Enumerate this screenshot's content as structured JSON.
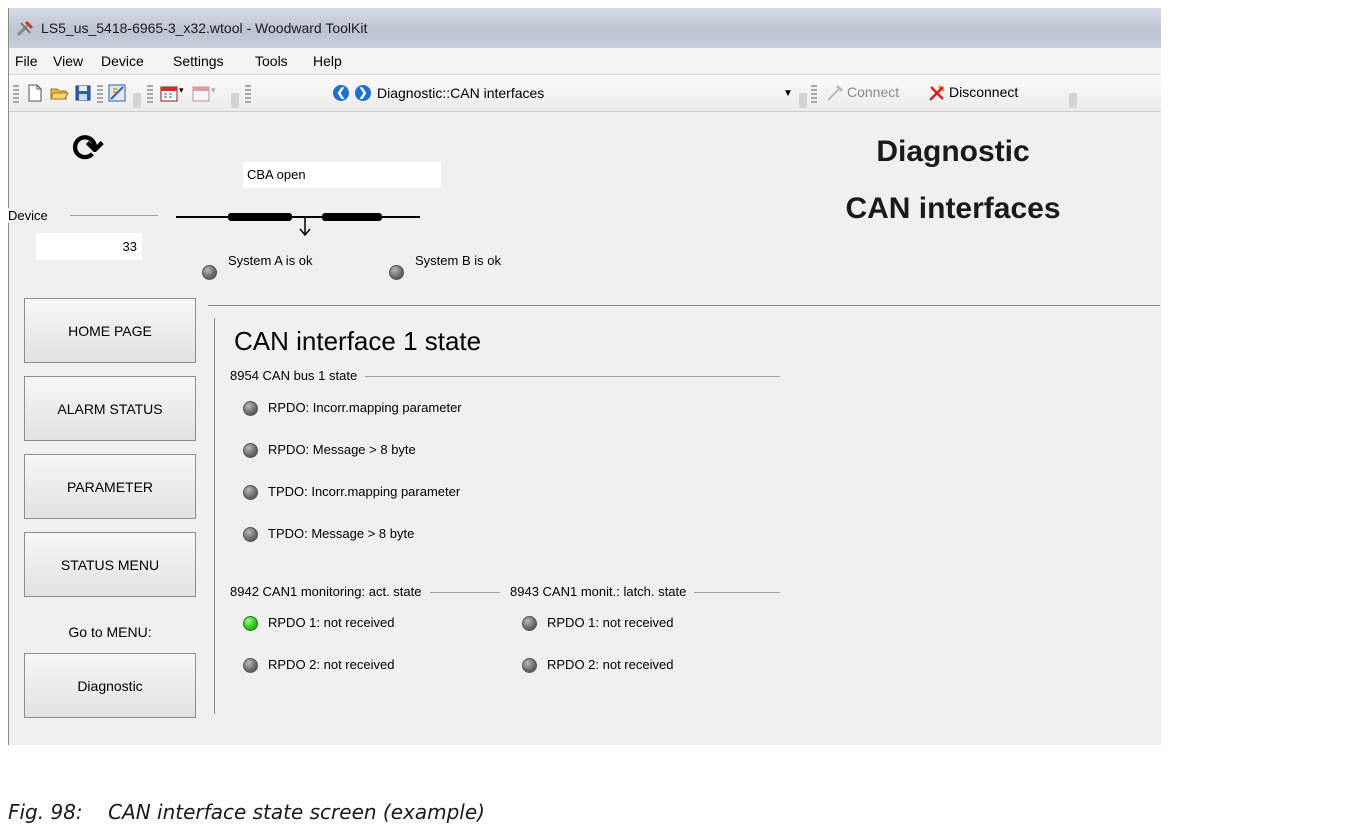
{
  "window": {
    "title": "LS5_us_5418-6965-3_x32.wtool - Woodward ToolKit"
  },
  "menu": [
    "File",
    "View",
    "Device",
    "Settings",
    "Tools",
    "Help"
  ],
  "toolbar": {
    "address": "Diagnostic::CAN interfaces",
    "connect_label": "Connect",
    "disconnect_label": "Disconnect"
  },
  "header": {
    "cb_status": "CBA open",
    "device_label": "Device",
    "device_value": "33",
    "system_a": "System A is ok",
    "system_b": "System B is ok",
    "page_title_line1": "Diagnostic",
    "page_title_line2": "CAN interfaces"
  },
  "sidebar": {
    "buttons": [
      "HOME PAGE",
      "ALARM STATUS",
      "PARAMETER",
      "STATUS MENU"
    ],
    "goto_label": "Go to MENU:",
    "goto_button": "Diagnostic"
  },
  "main": {
    "title": "CAN interface 1 state",
    "bus_group": "8954 CAN bus 1 state",
    "bus_items": [
      {
        "label": "RPDO: Incorr.mapping parameter",
        "state": "off"
      },
      {
        "label": "RPDO: Message > 8 byte",
        "state": "off"
      },
      {
        "label": "TPDO: Incorr.mapping parameter",
        "state": "off"
      },
      {
        "label": "TPDO: Message > 8 byte",
        "state": "off"
      }
    ],
    "act_group": "8942 CAN1 monitoring: act. state",
    "act_items": [
      {
        "label": "RPDO 1: not received",
        "state": "on"
      },
      {
        "label": "RPDO 2: not received",
        "state": "off"
      }
    ],
    "latch_group": "8943 CAN1 monit.: latch. state",
    "latch_items": [
      {
        "label": "RPDO 1: not received",
        "state": "off"
      },
      {
        "label": "RPDO 2: not received",
        "state": "off"
      }
    ]
  },
  "caption": "Fig. 98:    CAN interface state screen (example)",
  "colors": {
    "led_on": "#2fc61f",
    "led_off": "#6e6e6e"
  }
}
